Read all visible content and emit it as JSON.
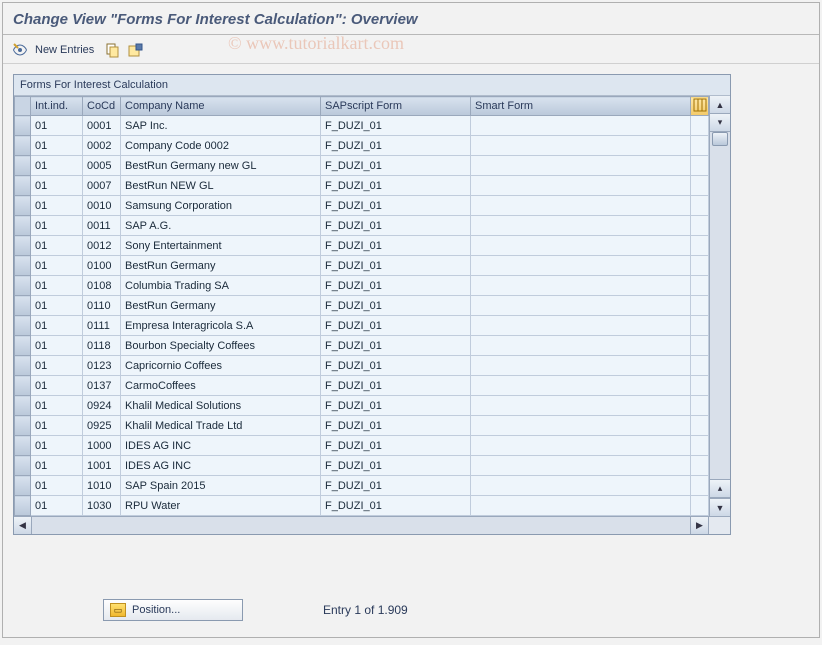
{
  "title": "Change View \"Forms For Interest Calculation\": Overview",
  "toolbar": {
    "new_entries_label": "New Entries"
  },
  "watermark": "© www.tutorialkart.com",
  "panel": {
    "title": "Forms For Interest Calculation",
    "columns": {
      "int_ind": "Int.ind.",
      "cocd": "CoCd",
      "company_name": "Company Name",
      "sapscript_form": "SAPscript Form",
      "smart_form": "Smart Form"
    },
    "rows": [
      {
        "int": "01",
        "cocd": "0001",
        "name": "SAP Inc.",
        "sap": "F_DUZI_01",
        "smart": ""
      },
      {
        "int": "01",
        "cocd": "0002",
        "name": "Company Code 0002",
        "sap": "F_DUZI_01",
        "smart": ""
      },
      {
        "int": "01",
        "cocd": "0005",
        "name": "BestRun Germany new GL",
        "sap": "F_DUZI_01",
        "smart": ""
      },
      {
        "int": "01",
        "cocd": "0007",
        "name": "BestRun NEW GL",
        "sap": "F_DUZI_01",
        "smart": ""
      },
      {
        "int": "01",
        "cocd": "0010",
        "name": "Samsung Corporation",
        "sap": "F_DUZI_01",
        "smart": ""
      },
      {
        "int": "01",
        "cocd": "0011",
        "name": "SAP A.G.",
        "sap": "F_DUZI_01",
        "smart": ""
      },
      {
        "int": "01",
        "cocd": "0012",
        "name": "Sony Entertainment",
        "sap": "F_DUZI_01",
        "smart": ""
      },
      {
        "int": "01",
        "cocd": "0100",
        "name": "BestRun Germany",
        "sap": "F_DUZI_01",
        "smart": ""
      },
      {
        "int": "01",
        "cocd": "0108",
        "name": "Columbia Trading SA",
        "sap": "F_DUZI_01",
        "smart": ""
      },
      {
        "int": "01",
        "cocd": "0110",
        "name": "BestRun Germany",
        "sap": "F_DUZI_01",
        "smart": ""
      },
      {
        "int": "01",
        "cocd": "0111",
        "name": "Empresa Interagricola S.A",
        "sap": "F_DUZI_01",
        "smart": ""
      },
      {
        "int": "01",
        "cocd": "0118",
        "name": "Bourbon Specialty Coffees",
        "sap": "F_DUZI_01",
        "smart": ""
      },
      {
        "int": "01",
        "cocd": "0123",
        "name": "Capricornio Coffees",
        "sap": "F_DUZI_01",
        "smart": ""
      },
      {
        "int": "01",
        "cocd": "0137",
        "name": "CarmoCoffees",
        "sap": "F_DUZI_01",
        "smart": ""
      },
      {
        "int": "01",
        "cocd": "0924",
        "name": "Khalil Medical Solutions",
        "sap": "F_DUZI_01",
        "smart": ""
      },
      {
        "int": "01",
        "cocd": "0925",
        "name": "Khalil Medical Trade Ltd",
        "sap": "F_DUZI_01",
        "smart": ""
      },
      {
        "int": "01",
        "cocd": "1000",
        "name": "IDES AG INC",
        "sap": "F_DUZI_01",
        "smart": ""
      },
      {
        "int": "01",
        "cocd": "1001",
        "name": "IDES AG INC",
        "sap": "F_DUZI_01",
        "smart": ""
      },
      {
        "int": "01",
        "cocd": "1010",
        "name": "SAP Spain 2015",
        "sap": "F_DUZI_01",
        "smart": ""
      },
      {
        "int": "01",
        "cocd": "1030",
        "name": "RPU Water",
        "sap": "F_DUZI_01",
        "smart": ""
      }
    ]
  },
  "footer": {
    "position_label": "Position...",
    "entry_text": "Entry 1 of 1.909"
  }
}
